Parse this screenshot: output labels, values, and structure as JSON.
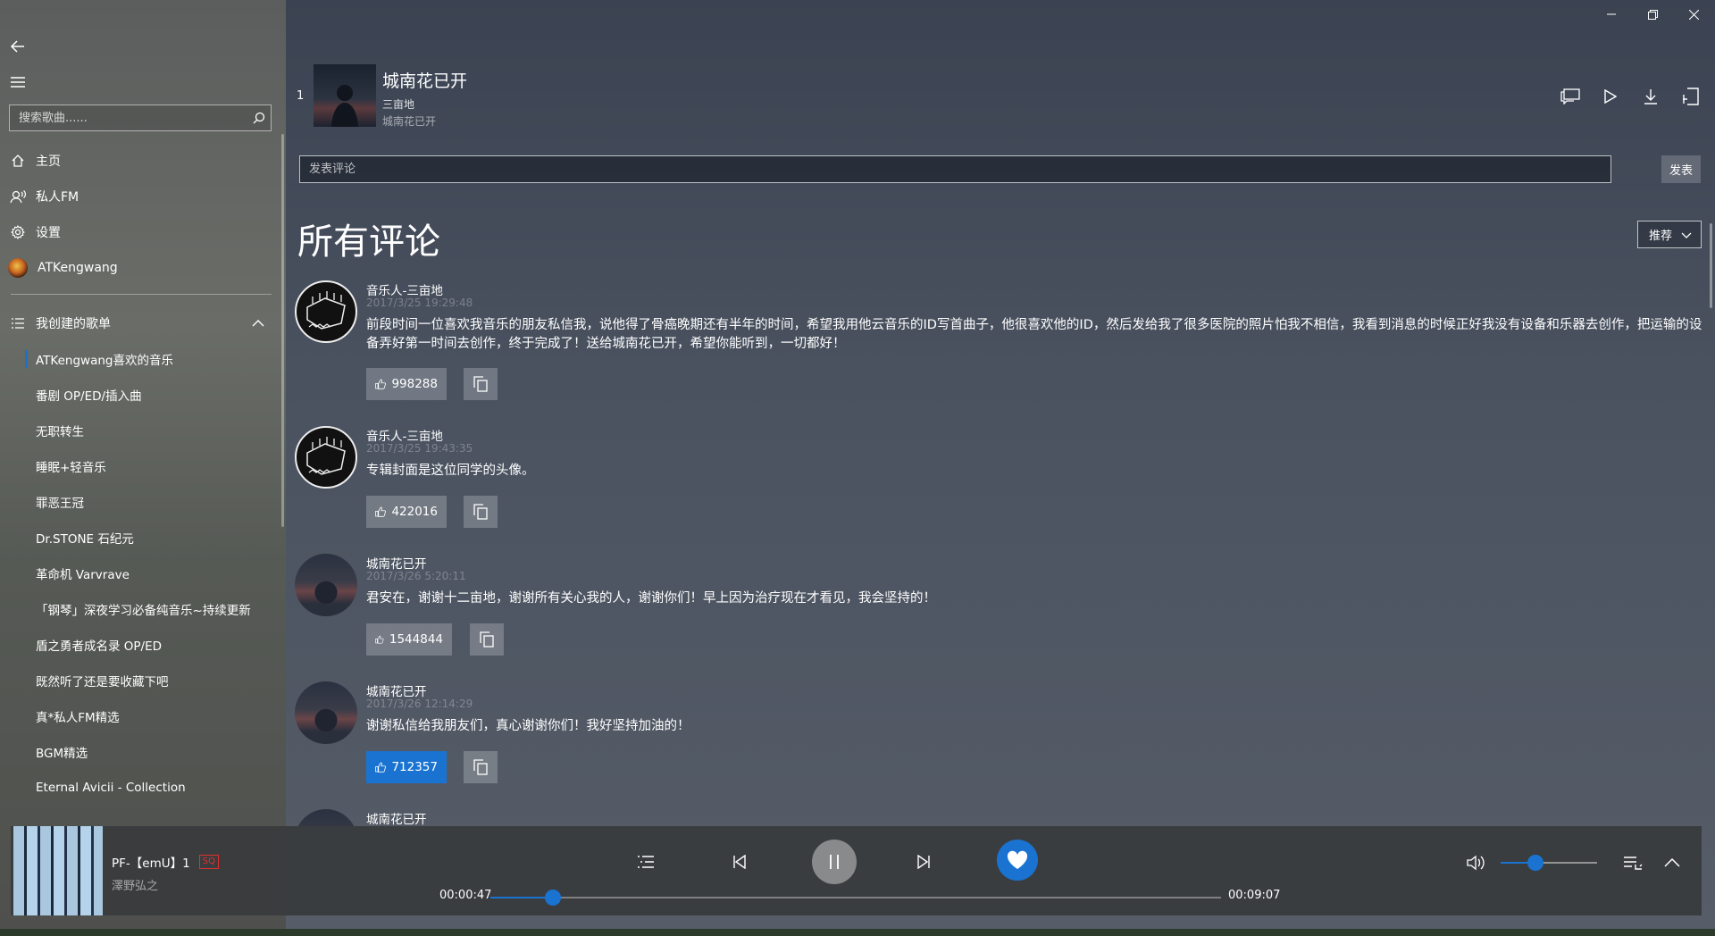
{
  "sidebar": {
    "search_placeholder": "搜索歌曲......",
    "nav": [
      {
        "label": "主页",
        "icon": "home-icon"
      },
      {
        "label": "私人FM",
        "icon": "radio-icon"
      },
      {
        "label": "设置",
        "icon": "gear-icon"
      },
      {
        "label": "ATKengwang",
        "icon": "avatar"
      }
    ],
    "section_title": "我创建的歌单",
    "playlists": [
      "ATKengwang喜欢的音乐",
      "番剧 OP/ED/插入曲",
      "无职转生",
      "睡眠+轻音乐",
      "罪恶王冠",
      "Dr.STONE 石纪元",
      "革命机 Varvrave",
      "「钢琴」深夜学习必备纯音乐~持续更新",
      "盾之勇者成名录 OP/ED",
      "既然听了还是要收藏下吧",
      "真*私人FM精选",
      "BGM精选",
      "Eternal Avicii - Collection"
    ],
    "active_playlist_index": 0
  },
  "song": {
    "index": "1",
    "title": "城南花已开",
    "artist": "三亩地",
    "album": "城南花已开"
  },
  "comment_box": {
    "placeholder": "发表评论",
    "post_label": "发表"
  },
  "comments_section": {
    "title": "所有评论",
    "sort_label": "推荐"
  },
  "comments": [
    {
      "user": "音乐人-三亩地",
      "time": "2017/3/25 19:29:48",
      "text": "前段时间一位喜欢我音乐的朋友私信我，说他得了骨癌晚期还有半年的时间，希望我用他云音乐的ID写首曲子，他很喜欢他的ID，然后发给我了很多医院的照片怕我不相信，我看到消息的时候正好我没有设备和乐器去创作，把运输的设备弄好第一时间去创作，终于完成了！送给城南花已开，希望你能听到，一切都好！",
      "likes": "998288",
      "liked": false,
      "avatar": "doodle"
    },
    {
      "user": "音乐人-三亩地",
      "time": "2017/3/25 19:43:35",
      "text": "专辑封面是这位同学的头像。",
      "likes": "422016",
      "liked": false,
      "avatar": "doodle"
    },
    {
      "user": "城南花已开",
      "time": "2017/3/26 5:20:11",
      "text": "君安在，谢谢十二亩地，谢谢所有关心我的人，谢谢你们！早上因为治疗现在才看见，我会坚持的！",
      "likes": "1544844",
      "liked": false,
      "avatar": "photo"
    },
    {
      "user": "城南花已开",
      "time": "2017/3/26 12:14:29",
      "text": "谢谢私信给我朋友们，真心谢谢你们！我好坚持加油的！",
      "likes": "712357",
      "liked": true,
      "avatar": "photo"
    },
    {
      "user": "城南花已开",
      "time": "",
      "text": "",
      "likes": "",
      "liked": false,
      "avatar": "photo"
    }
  ],
  "player": {
    "title": "PF-【emU】1",
    "quality_badge": "SQ",
    "artist": "澤野弘之",
    "time_current": "00:00:47",
    "time_total": "00:09:07",
    "progress": 0.086,
    "volume": 0.36,
    "accent_color": "#1a73d0",
    "icons": [
      "playlist-icon",
      "prev-icon",
      "pause-icon",
      "next-icon",
      "heart-icon",
      "volume-icon",
      "queue-icon",
      "expand-icon"
    ]
  }
}
